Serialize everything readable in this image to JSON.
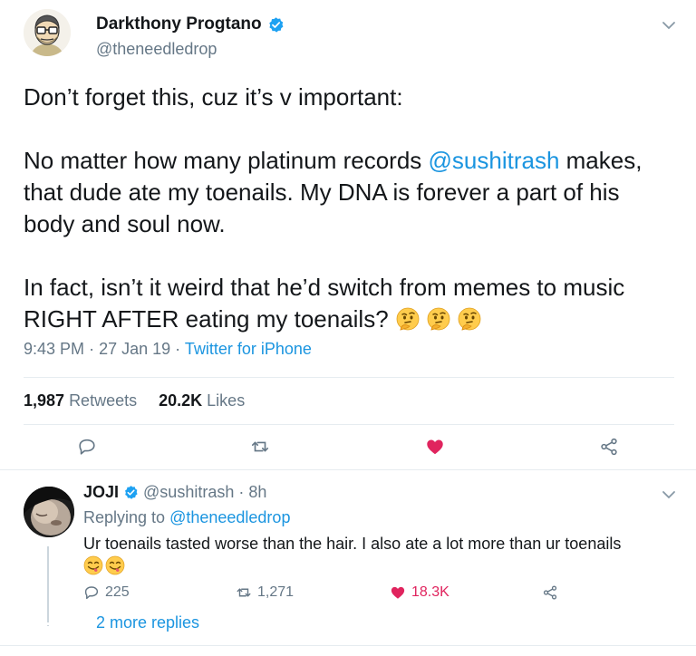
{
  "tweet": {
    "author_name": "Darkthony Progtano",
    "author_handle": "@theneedledrop",
    "text_line1": "Don’t forget this, cuz it’s v important:",
    "text_p2_before": "No matter how many platinum records ",
    "text_p2_mention": "@sushitrash",
    "text_p2_after": " makes, that dude ate my toenails. My DNA is forever a part of his body and soul now.",
    "text_p3": "In fact, isn’t it weird that he’d switch from memes to music RIGHT AFTER eating my toenails?",
    "time": "9:43 PM",
    "date": "27 Jan 19",
    "source": "Twitter for iPhone",
    "retweets_count": "1,987",
    "retweets_label": "Retweets",
    "likes_count": "20.2K",
    "likes_label": "Likes"
  },
  "reply": {
    "author_name": "JOJI",
    "author_handle": "@sushitrash",
    "age": "8h",
    "replying_label": "Replying to",
    "replying_to": "@theneedledrop",
    "text": "Ur toenails tasted worse than the hair. I also ate a lot more than ur toenails",
    "reply_count": "225",
    "retweet_count": "1,271",
    "like_count": "18.3K",
    "more_replies": "2 more replies"
  },
  "icons": {
    "verified": "verified-badge-icon",
    "thinking": "thinking-face-emoji",
    "yum": "face-savoring-food-emoji",
    "reply": "reply-icon",
    "retweet": "retweet-icon",
    "like": "heart-icon",
    "share": "share-icon",
    "chevron": "chevron-down-icon"
  },
  "colors": {
    "link": "#1b95e0",
    "secondary_text": "#657786",
    "like": "#e0245e",
    "divider": "#e6ecf0"
  }
}
